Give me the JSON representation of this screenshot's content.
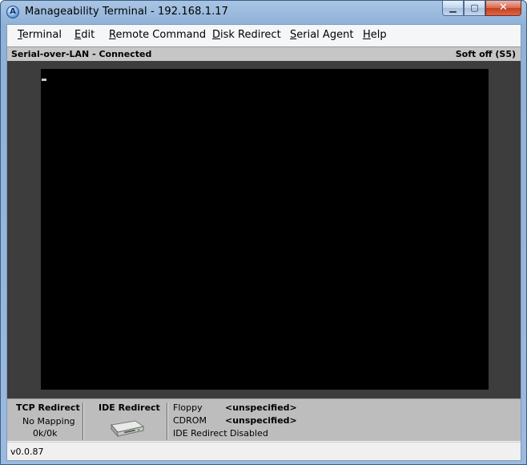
{
  "window": {
    "title": "Manageability Terminal - 192.168.1.17",
    "app_icon_letter": "A",
    "minimize_glyph": "▁",
    "maximize_glyph": "▢",
    "close_glyph": "✕"
  },
  "menu": {
    "items": [
      {
        "accel": "T",
        "rest": "erminal"
      },
      {
        "accel": "E",
        "rest": "dit"
      },
      {
        "accel": "R",
        "rest": "emote Command"
      },
      {
        "accel": "D",
        "rest": "isk Redirect"
      },
      {
        "accel": "S",
        "rest": "erial Agent"
      },
      {
        "accel": "H",
        "rest": "elp"
      }
    ]
  },
  "status": {
    "connection": "Serial-over-LAN - Connected",
    "power_state": "Soft off (S5)"
  },
  "terminal": {
    "background": "#000000",
    "cursor_color": "#c8c8c8"
  },
  "panel": {
    "tcp_redirect": {
      "title": "TCP Redirect",
      "mapping": "No Mapping",
      "traffic": "0k/0k"
    },
    "ide_redirect": {
      "title": "IDE Redirect",
      "icon": "disk-drive-icon"
    },
    "media": {
      "floppy_label": "Floppy",
      "floppy_value": "<unspecified>",
      "cdrom_label": "CDROM",
      "cdrom_value": "<unspecified>",
      "ide_status": "IDE Redirect Disabled"
    }
  },
  "footer": {
    "version": "v0.0.87"
  }
}
